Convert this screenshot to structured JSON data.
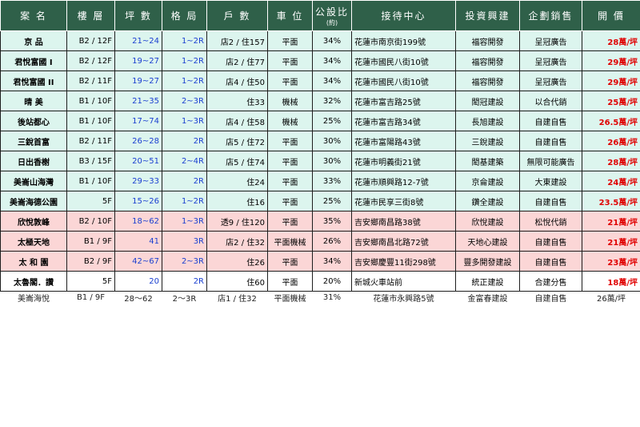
{
  "headers": [
    "案 名",
    "樓 層",
    "坪 數",
    "格 局",
    "戶 數",
    "車 位",
    "公設比",
    "(約)",
    "接待中心",
    "投資興建",
    "企劃銷售",
    "開 價"
  ],
  "rows": [
    {
      "name": "京 品",
      "floor": "B2 / 12F",
      "area": "21~24",
      "layout": "1~2R",
      "units": "店2 / 住157",
      "parking": "平面",
      "ratio": "34%",
      "center": "花蓮市南京街199號",
      "builder": "福容開發",
      "sales": "呈冠廣告",
      "price": "28萬/坪",
      "tone": "mint"
    },
    {
      "name": "君悅富國 I",
      "floor": "B2 / 12F",
      "area": "19~27",
      "layout": "1~2R",
      "units": "店2 / 住77",
      "parking": "平面",
      "ratio": "34%",
      "center": "花蓮市國民八街10號",
      "builder": "福容開發",
      "sales": "呈冠廣告",
      "price": "29萬/坪",
      "tone": "mint"
    },
    {
      "name": "君悅富國 II",
      "floor": "B2 / 11F",
      "area": "19~27",
      "layout": "1~2R",
      "units": "店4 / 住50",
      "parking": "平面",
      "ratio": "34%",
      "center": "花蓮市國民八街10號",
      "builder": "福容開發",
      "sales": "呈冠廣告",
      "price": "29萬/坪",
      "tone": "mint"
    },
    {
      "name": "晴 美",
      "floor": "B1 / 10F",
      "area": "21~35",
      "layout": "2~3R",
      "units": "住33",
      "parking": "機械",
      "ratio": "32%",
      "center": "花蓮市富吉路25號",
      "builder": "閎冠建設",
      "sales": "以合代銷",
      "price": "25萬/坪",
      "tone": "mint"
    },
    {
      "name": "後站都心",
      "floor": "B1 / 10F",
      "area": "17~74",
      "layout": "1~3R",
      "units": "店4 / 住58",
      "parking": "機械",
      "ratio": "25%",
      "center": "花蓮市富吉路34號",
      "builder": "長旭建設",
      "sales": "自建自售",
      "price": "26.5萬/坪",
      "tone": "mint"
    },
    {
      "name": "三銳首富",
      "floor": "B2 / 11F",
      "area": "26~28",
      "layout": "2R",
      "units": "店5 / 住72",
      "parking": "平面",
      "ratio": "30%",
      "center": "花蓮市富陽路43號",
      "builder": "三銳建設",
      "sales": "自建自售",
      "price": "26萬/坪",
      "tone": "mint"
    },
    {
      "name": "日出香榭",
      "floor": "B3 / 15F",
      "area": "20~51",
      "layout": "2~4R",
      "units": "店5 / 住74",
      "parking": "平面",
      "ratio": "30%",
      "center": "花蓮市明義街21號",
      "builder": "閎基建築",
      "sales": "無限可能廣告",
      "price": "28萬/坪",
      "tone": "mint"
    },
    {
      "name": "美崙山海灣",
      "floor": "B1 / 10F",
      "area": "29~33",
      "layout": "2R",
      "units": "住24",
      "parking": "平面",
      "ratio": "33%",
      "center": "花蓮市順興路12-7號",
      "builder": "京侖建設",
      "sales": "大東建設",
      "price": "24萬/坪",
      "tone": "mint"
    },
    {
      "name": "美崙海德公園",
      "floor": "5F",
      "area": "15~26",
      "layout": "1~2R",
      "units": "住16",
      "parking": "平面",
      "ratio": "25%",
      "center": "花蓮市民享三街8號",
      "builder": "鑽全建設",
      "sales": "自建自售",
      "price": "23.5萬/坪",
      "tone": "mint"
    },
    {
      "name": "欣悅敦峰",
      "floor": "B2 / 10F",
      "area": "18~62",
      "layout": "1~3R",
      "units": "透9 / 住120",
      "parking": "平面",
      "ratio": "35%",
      "center": "吉安鄉南昌路38號",
      "builder": "欣悅建設",
      "sales": "松悅代銷",
      "price": "21萬/坪",
      "tone": "pink"
    },
    {
      "name": "太極天地",
      "floor": "B1 / 9F",
      "area": "41",
      "layout": "3R",
      "units": "店2 / 住32",
      "parking": "平面機械",
      "ratio": "26%",
      "center": "吉安鄉南昌北路72號",
      "builder": "天地心建設",
      "sales": "自建自售",
      "price": "21萬/坪",
      "tone": "pink"
    },
    {
      "name": "太 和 園",
      "floor": "B2 / 9F",
      "area": "42~67",
      "layout": "2~3R",
      "units": "住26",
      "parking": "平面",
      "ratio": "34%",
      "center": "吉安鄉慶豐11街298號",
      "builder": "豐多開發建設",
      "sales": "自建自售",
      "price": "23萬/坪",
      "tone": "pink"
    },
    {
      "name": "太魯閣．讚",
      "floor": "5F",
      "area": "20",
      "layout": "2R",
      "units": "住60",
      "parking": "平面",
      "ratio": "20%",
      "center": "新城火車站前",
      "builder": "統正建設",
      "sales": "合建分售",
      "price": "18萬/坪",
      "tone": "white"
    }
  ],
  "footer": {
    "name": "美崙海悅",
    "floor": "B1 / 9F",
    "area": "28～62",
    "layout": "2～3R",
    "units": "店1 / 住32",
    "parking": "平面機械",
    "ratio": "31%",
    "center": "花蓮市永興路5號",
    "builder": "金富春建設",
    "sales": "自建自售",
    "price": "26萬/坪"
  }
}
